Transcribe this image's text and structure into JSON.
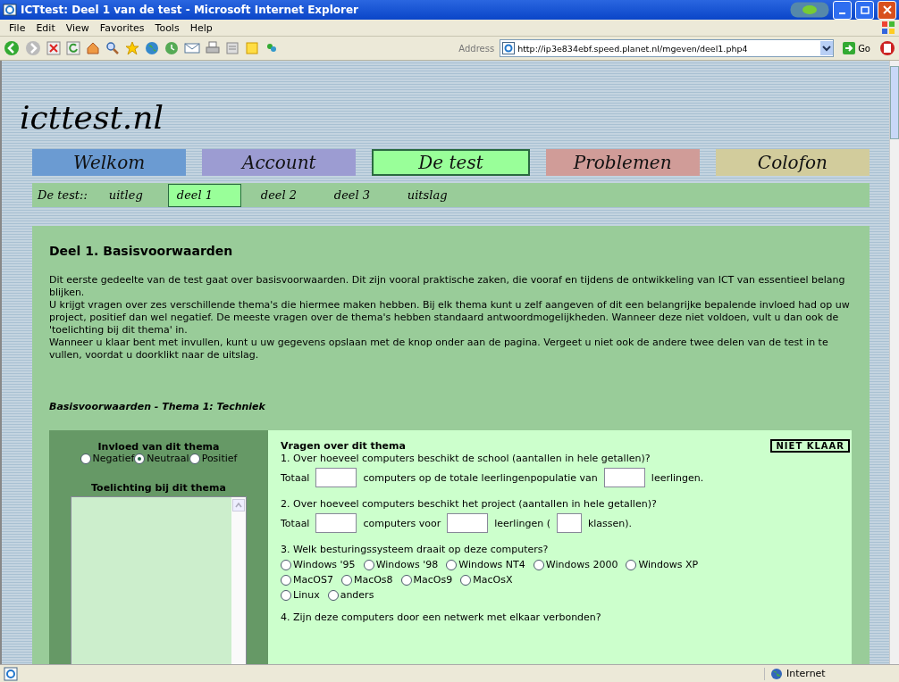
{
  "window": {
    "title": "ICTtest: Deel 1 van de test - Microsoft Internet Explorer"
  },
  "menu": [
    "File",
    "Edit",
    "View",
    "Favorites",
    "Tools",
    "Help"
  ],
  "address": {
    "label": "Address",
    "value": "http://ip3e834ebf.speed.planet.nl/mgeven/deel1.php4",
    "go": "Go"
  },
  "site": {
    "logo": "icttest.nl"
  },
  "tabs": [
    {
      "label": "Welkom",
      "color": "#6b9bd2",
      "selected": false
    },
    {
      "label": "Account",
      "color": "#9c9cd2",
      "selected": false
    },
    {
      "label": "De test",
      "color": "#99ff99",
      "selected": true
    },
    {
      "label": "Problemen",
      "color": "#d09c98",
      "selected": false
    },
    {
      "label": "Colofon",
      "color": "#d2cc9c",
      "selected": false
    }
  ],
  "subnav": {
    "label": "De test::",
    "items": [
      {
        "label": "uitleg",
        "selected": false
      },
      {
        "label": "deel 1",
        "selected": true
      },
      {
        "label": "deel 2",
        "selected": false
      },
      {
        "label": "deel 3",
        "selected": false
      },
      {
        "label": "uitslag",
        "selected": false
      }
    ]
  },
  "content": {
    "heading": "Deel 1. Basisvoorwaarden",
    "paragraphs": [
      "Dit eerste gedeelte van de test gaat over basisvoorwaarden. Dit zijn vooral praktische zaken, die vooraf en tijdens de ontwikkeling van ICT van essentieel belang blijken.",
      "U krijgt vragen over zes verschillende thema's die hiermee maken hebben. Bij elk thema kunt u zelf aangeven of dit een belangrijke bepalende invloed had op uw project, positief dan wel negatief. De meeste vragen over de thema's hebben standaard antwoordmogelijkheden. Wanneer deze niet voldoen, vult u dan ook de 'toelichting bij dit thema' in.",
      "Wanneer u klaar bent met invullen, kunt u uw gegevens opslaan met de knop onder aan de pagina. Vergeet u niet ook de andere twee delen van de test in te vullen, voordat u doorklikt naar de uitslag."
    ],
    "theme_title": "Basisvoorwaarden - Thema 1: Techniek"
  },
  "theme": {
    "influence_title": "Invloed van dit thema",
    "influence": [
      {
        "label": "Negatief",
        "selected": false
      },
      {
        "label": "Neutraal",
        "selected": true
      },
      {
        "label": "Positief",
        "selected": false
      }
    ],
    "comment_title": "Toelichting bij dit thema",
    "questions_title": "Vragen over dit thema",
    "status": "NIET KLAAR",
    "questions": [
      {
        "text": "1. Over hoeveel computers beschikt de school (aantallen in hele getallen)?",
        "lines": [
          {
            "parts": [
              {
                "kind": "text",
                "text": "Totaal"
              },
              {
                "kind": "input"
              },
              {
                "kind": "text",
                "text": "computers op de totale leerlingenpopulatie van"
              },
              {
                "kind": "input"
              },
              {
                "kind": "text",
                "text": "leerlingen."
              }
            ]
          }
        ]
      },
      {
        "text": "2. Over hoeveel computers beschikt het project (aantallen in hele getallen)?",
        "lines": [
          {
            "parts": [
              {
                "kind": "text",
                "text": "Totaal"
              },
              {
                "kind": "input"
              },
              {
                "kind": "text",
                "text": "computers voor"
              },
              {
                "kind": "input"
              },
              {
                "kind": "text",
                "text": "leerlingen ("
              },
              {
                "kind": "small-input"
              },
              {
                "kind": "text",
                "text": "klassen)."
              }
            ]
          }
        ]
      },
      {
        "text": "3. Welk besturingssysteem draait op deze computers?",
        "lines": [
          {
            "parts": [
              {
                "kind": "radio",
                "text": "Windows '95",
                "selected": false
              },
              {
                "kind": "radio",
                "text": "Windows '98",
                "selected": false
              },
              {
                "kind": "radio",
                "text": "Windows NT4",
                "selected": false
              },
              {
                "kind": "radio",
                "text": "Windows 2000",
                "selected": false
              },
              {
                "kind": "radio",
                "text": "Windows XP",
                "selected": false
              }
            ]
          },
          {
            "parts": [
              {
                "kind": "radio",
                "text": "MacOS7",
                "selected": false
              },
              {
                "kind": "radio",
                "text": "MacOs8",
                "selected": false
              },
              {
                "kind": "radio",
                "text": "MacOs9",
                "selected": false
              },
              {
                "kind": "radio",
                "text": "MacOsX",
                "selected": false
              }
            ]
          },
          {
            "parts": [
              {
                "kind": "radio",
                "text": "Linux",
                "selected": false
              },
              {
                "kind": "radio",
                "text": "anders",
                "selected": false
              }
            ]
          }
        ]
      },
      {
        "text": "4. Zijn deze computers door een netwerk met elkaar verbonden?"
      }
    ]
  },
  "status_bar": {
    "zone": "Internet"
  }
}
